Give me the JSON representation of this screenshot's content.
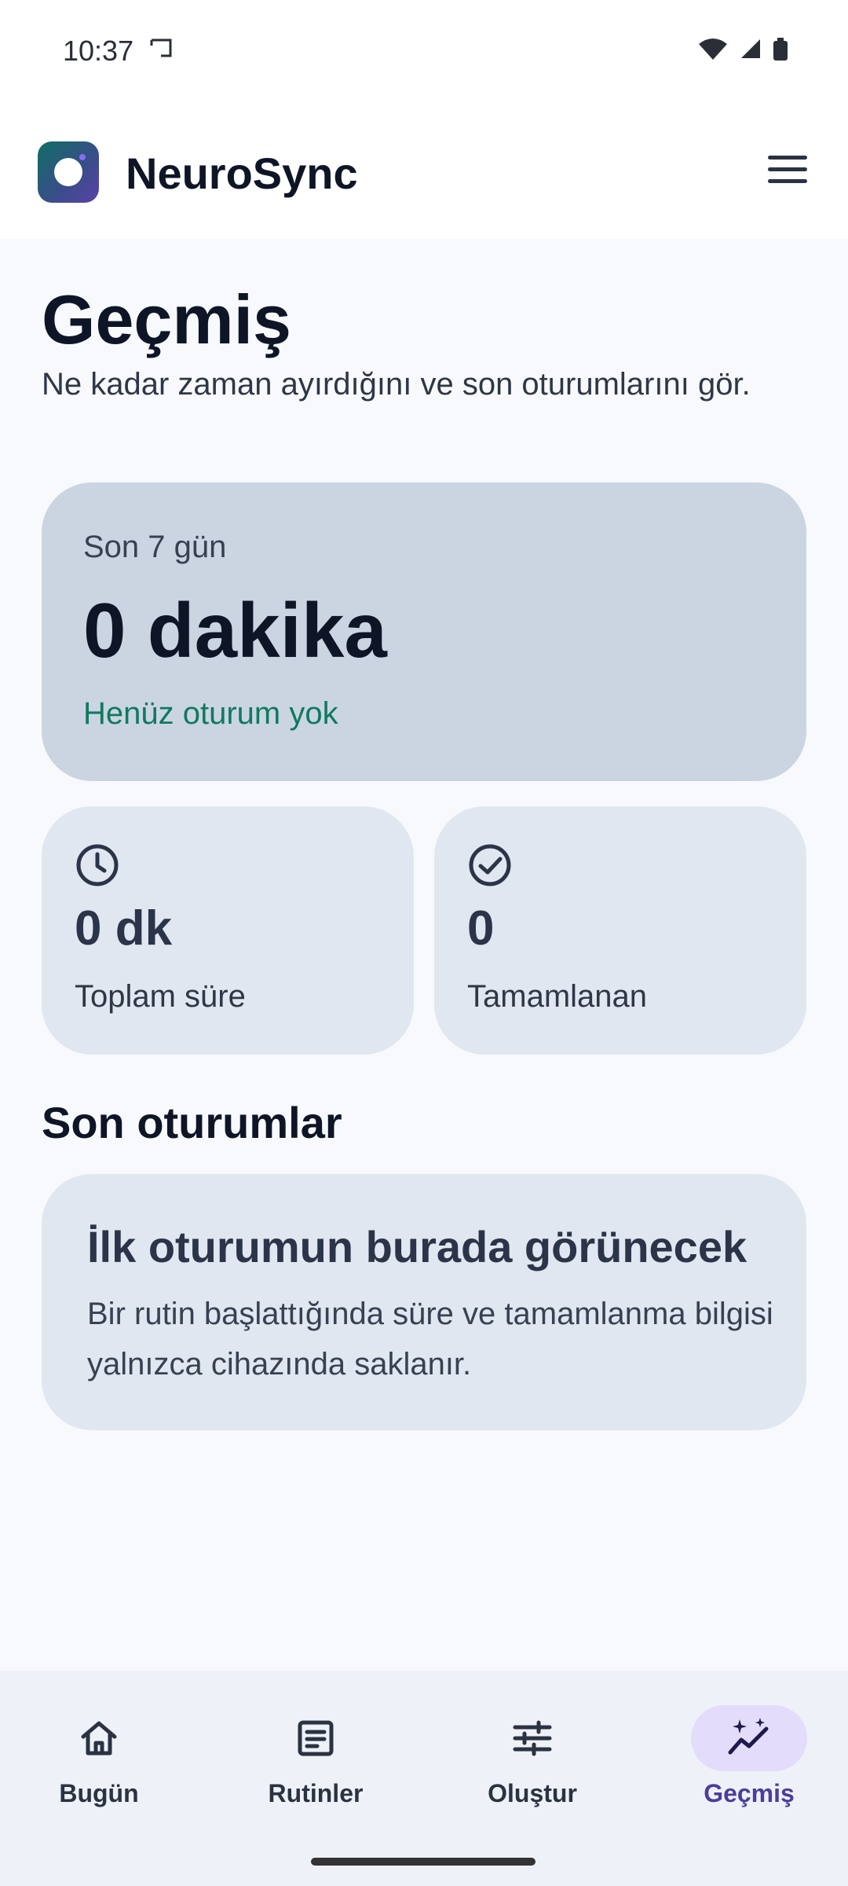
{
  "status_bar": {
    "time": "10:37",
    "icons": [
      "cast-icon",
      "wifi-icon",
      "signal-icon",
      "battery-icon"
    ]
  },
  "app_bar": {
    "title": "NeuroSync",
    "logo": "neurosync-logo-icon",
    "menu_icon": "menu-icon"
  },
  "page": {
    "title": "Geçmiş",
    "subtitle": "Ne kadar zaman ayırdığını ve son oturumlarını gör."
  },
  "week_card": {
    "label": "Son 7 gün",
    "value": "0 dakika",
    "status": "Henüz oturum yok"
  },
  "stats": [
    {
      "icon": "clock-icon",
      "value": "0 dk",
      "label": "Toplam süre"
    },
    {
      "icon": "check-circle-icon",
      "value": "0",
      "label": "Tamamlanan"
    }
  ],
  "recent": {
    "section_title": "Son oturumlar",
    "empty_title": "İlk oturumun burada görünecek",
    "empty_text": "Bir rutin başlattığında süre ve tamamlanma bilgisi yalnızca cihazında saklanır."
  },
  "bottom_nav": {
    "items": [
      {
        "label": "Bugün",
        "icon": "home-icon",
        "active": false
      },
      {
        "label": "Rutinler",
        "icon": "document-icon",
        "active": false
      },
      {
        "label": "Oluştur",
        "icon": "sliders-icon",
        "active": false
      },
      {
        "label": "Geçmiş",
        "icon": "sparkle-trend-icon",
        "active": true
      }
    ]
  },
  "colors": {
    "accent": "#0F7A5F",
    "nav_active_bg": "#E4DCFB",
    "nav_active_text": "#4B3E9A",
    "card_primary": "#CBD5E1",
    "card_secondary": "#E1E7F0"
  }
}
